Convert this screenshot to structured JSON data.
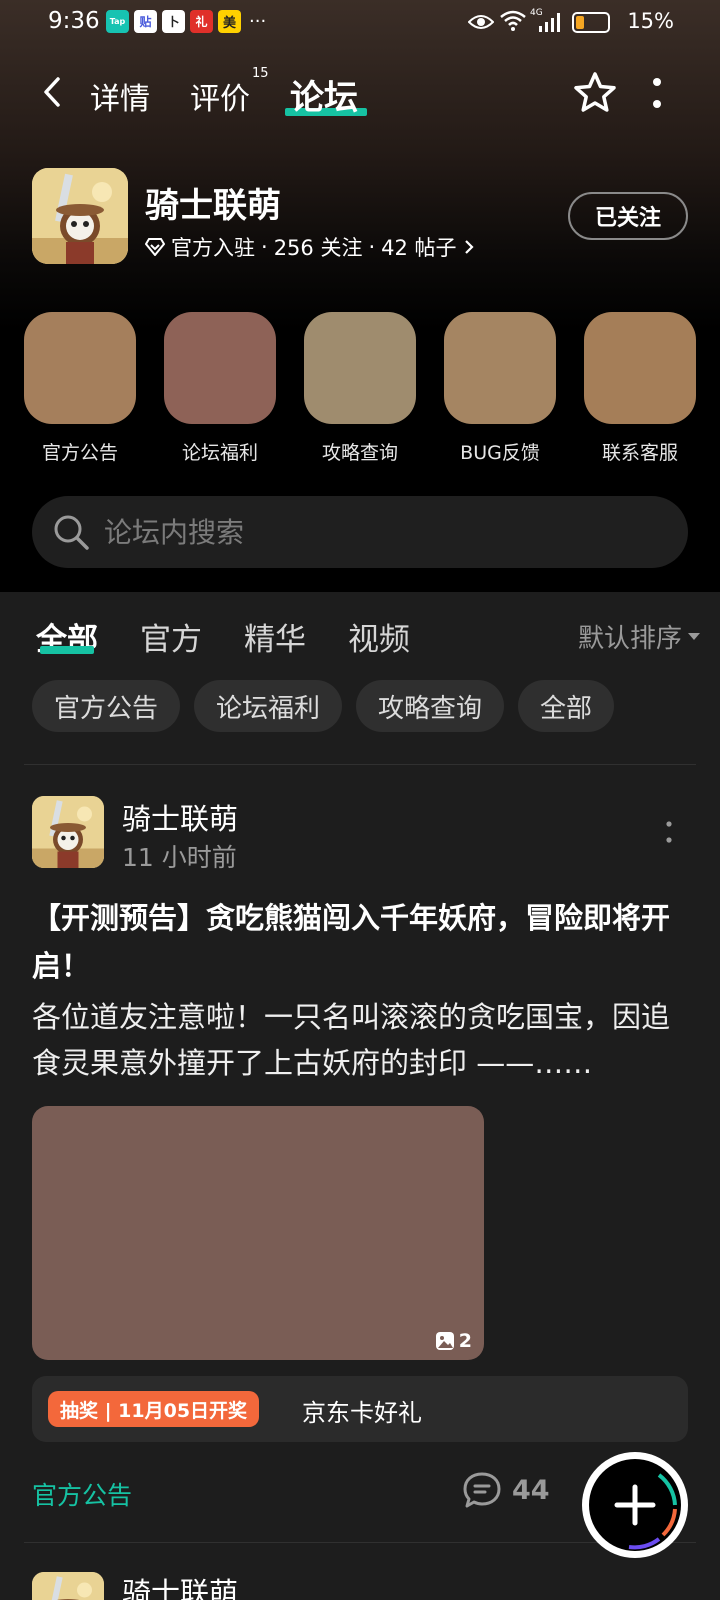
{
  "status_bar": {
    "time": "9:36",
    "notification_icons": [
      {
        "name": "taptap-icon",
        "label": "Tap",
        "color": "#17c3b2"
      },
      {
        "name": "tieba-icon",
        "label": "贴",
        "color": "#4a5bdc"
      },
      {
        "name": "app-icon",
        "label": "卜",
        "color": "#ffffff"
      },
      {
        "name": "gift-app-icon",
        "label": "礼",
        "color": "#e0302a"
      },
      {
        "name": "meituan-icon",
        "label": "美",
        "color": "#ffd100"
      }
    ],
    "more": "···",
    "network": "4G",
    "battery": "15%"
  },
  "nav": {
    "tabs": [
      {
        "label": "详情"
      },
      {
        "label": "评价",
        "badge": "15"
      },
      {
        "label": "论坛"
      }
    ],
    "active_tab": "论坛"
  },
  "app": {
    "title": "骑士联萌",
    "meta_official": "官方入驻",
    "meta_sep": "·",
    "meta_followers": "256 关注",
    "meta_posts": "42 帖子",
    "follow_label": "已关注"
  },
  "quick_actions": [
    {
      "label": "官方公告",
      "color": "#a57f5c"
    },
    {
      "label": "论坛福利",
      "color": "#8e6257"
    },
    {
      "label": "攻略查询",
      "color": "#9f8c6e"
    },
    {
      "label": "BUG反馈",
      "color": "#a58562"
    },
    {
      "label": "联系客服",
      "color": "#a57e58"
    }
  ],
  "search": {
    "placeholder": "论坛内搜索"
  },
  "feed": {
    "tabs": [
      "全部",
      "官方",
      "精华",
      "视频"
    ],
    "active_tab": "全部",
    "sort_label": "默认排序",
    "chips": [
      "官方公告",
      "论坛福利",
      "攻略查询",
      "全部"
    ]
  },
  "post": {
    "author": "骑士联萌",
    "time": "11 小时前",
    "title": "【开测预告】贪吃熊猫闯入千年妖府，冒险即将开启！",
    "body": "各位道友注意啦！一只名叫滚滚的贪吃国宝，因追食灵果意外撞开了上古妖府的封印 ——……",
    "image_color": "#7a5d55",
    "image_count": "2",
    "lottery_badge": "抽奖 | 11月05日开奖",
    "lottery_text": "京东卡好礼",
    "tag": "官方公告",
    "comment_count": "44"
  },
  "next_post": {
    "author": "骑士联萌"
  },
  "colors": {
    "accent": "#16c2a3",
    "lottery": "#f3683b",
    "feed_bg": "#1d1d1d"
  }
}
